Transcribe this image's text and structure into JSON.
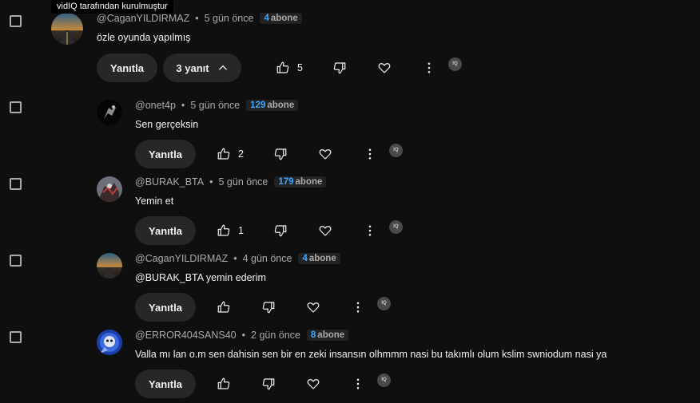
{
  "tooltip": "vidIQ tarafından kurulmuştur",
  "comments": [
    {
      "author": "@CaganYILDIRMAZ",
      "time": "5 gün önce",
      "subs_count": "4",
      "subs_label": "abone",
      "text": "özle oyunda yapılmış",
      "reply_label": "Yanıtla",
      "replies_label": "3 yanıt",
      "likes": "5",
      "vidiq_label": "IQ"
    },
    {
      "author": "@onet4p",
      "time": "5 gün önce",
      "subs_count": "129",
      "subs_label": "abone",
      "text": "Sen gerçeksin",
      "reply_label": "Yanıtla",
      "likes": "2",
      "vidiq_label": "IQ"
    },
    {
      "author": "@BURAK_BTA",
      "time": "5 gün önce",
      "subs_count": "179",
      "subs_label": "abone",
      "text": "Yemin et",
      "reply_label": "Yanıtla",
      "likes": "1",
      "vidiq_label": "IQ"
    },
    {
      "author": "@CaganYILDIRMAZ",
      "time": "4 gün önce",
      "subs_count": "4",
      "subs_label": "abone",
      "text": "@BURAK_BTA yemin ederim",
      "reply_label": "Yanıtla",
      "likes": "",
      "vidiq_label": "IQ"
    },
    {
      "author": "@ERROR404SANS40",
      "time": "2 gün önce",
      "subs_count": "8",
      "subs_label": "abone",
      "text": "Valla mı lan o.m sen dahisin sen bir en zeki insansın olhmmm nasi bu takımlı olum kslim swniodum nasi ya",
      "reply_label": "Yanıtla",
      "likes": "",
      "vidiq_label": "IQ"
    }
  ],
  "colors": {
    "background": "#0f0f0f",
    "badge_number": "#3ea6ff",
    "meta": "#aaaaaa",
    "pill": "#272727"
  },
  "icons": [
    "checkbox-icon",
    "like-icon",
    "dislike-icon",
    "heart-icon",
    "more-icon",
    "vidiq-icon",
    "chevron-up-icon"
  ]
}
